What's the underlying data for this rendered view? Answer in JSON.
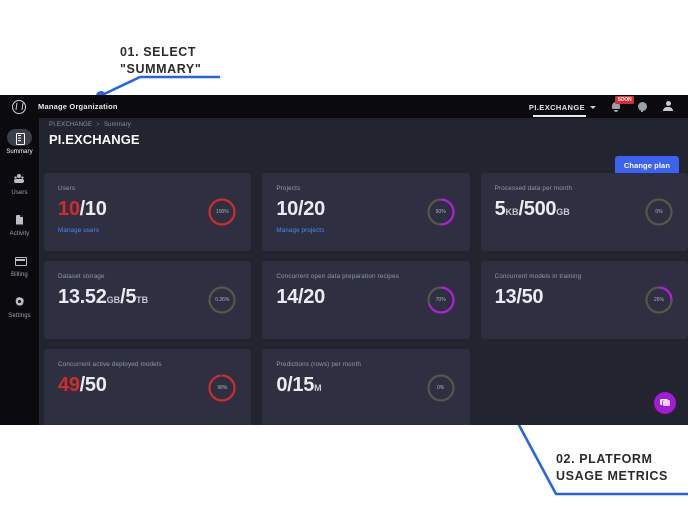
{
  "annotations": [
    {
      "id": "a1",
      "text": "01. SELECT\n\"SUMMARY\""
    },
    {
      "id": "a2",
      "text": "02. PLATFORM\nUSAGE METRICS"
    }
  ],
  "colors": {
    "accent_blue": "#3b63f0",
    "annotation_blue": "#2563eb",
    "danger_red": "#d22b2b",
    "ring_purple": "#b51ae0",
    "chat_purple": "#a31bd4",
    "app_bg": "#22242f",
    "card_bg": "#2e3042",
    "rail_bg": "#0b0b0f"
  },
  "topbar": {
    "logo_icon": "pi-exchange-logo-icon",
    "title": "Manage Organization",
    "org_switcher": {
      "label": "PI.EXCHANGE",
      "caret_icon": "chevron-down-icon"
    },
    "bell_icon": "bell-icon",
    "notification_badge": "SOON",
    "help_icon": "help-globe-icon",
    "user_icon": "user-avatar-icon"
  },
  "sidebar": {
    "items": [
      {
        "label": "Summary",
        "icon": "summary-icon",
        "active": true
      },
      {
        "label": "Users",
        "icon": "users-icon",
        "active": false
      },
      {
        "label": "Activity",
        "icon": "activity-icon",
        "active": false
      },
      {
        "label": "Billing",
        "icon": "billing-icon",
        "active": false
      },
      {
        "label": "Settings",
        "icon": "settings-icon",
        "active": false
      }
    ]
  },
  "main": {
    "breadcrumb": {
      "root": "PI.EXCHANGE",
      "separator": ">",
      "current": "Summary"
    },
    "page_title": "PI.EXCHANGE",
    "change_plan_label": "Change plan",
    "chat_icon": "chat-bubble-icon"
  },
  "chart_data": {
    "type": "table",
    "title": "Platform usage metrics",
    "columns": [
      "metric",
      "used",
      "unit_used",
      "limit",
      "unit_limit",
      "percent"
    ],
    "rows": [
      {
        "metric": "Users",
        "used": "10",
        "unit_used": "",
        "limit": "10",
        "unit_limit": "",
        "percent": 100,
        "percent_label": "100%",
        "color": "#d22b2b",
        "danger": true,
        "link": "Manage users"
      },
      {
        "metric": "Projects",
        "used": "10",
        "unit_used": "",
        "limit": "20",
        "unit_limit": "",
        "percent": 50,
        "percent_label": "50%",
        "color": "#b51ae0",
        "danger": false,
        "link": "Manage projects"
      },
      {
        "metric": "Processed data per month",
        "used": "5",
        "unit_used": "KB",
        "limit": "500",
        "unit_limit": "GB",
        "percent": 0,
        "percent_label": "0%",
        "color": "#6e6f5a",
        "danger": false,
        "link": ""
      },
      {
        "metric": "Dataset storage",
        "used": "13.52",
        "unit_used": "GB",
        "limit": "5",
        "unit_limit": "TB",
        "percent": 0.26,
        "percent_label": "0.26%",
        "color": "#6e6f5a",
        "danger": false,
        "link": ""
      },
      {
        "metric": "Concurrent open data preparation recipes",
        "used": "14",
        "unit_used": "",
        "limit": "20",
        "unit_limit": "",
        "percent": 70,
        "percent_label": "70%",
        "color": "#b51ae0",
        "danger": false,
        "link": ""
      },
      {
        "metric": "Concurrent models in training",
        "used": "13",
        "unit_used": "",
        "limit": "50",
        "unit_limit": "",
        "percent": 26,
        "percent_label": "26%",
        "color": "#b51ae0",
        "danger": false,
        "link": ""
      },
      {
        "metric": "Concurrent active deployed models",
        "used": "49",
        "unit_used": "",
        "limit": "50",
        "unit_limit": "",
        "percent": 98,
        "percent_label": "98%",
        "color": "#d22b2b",
        "danger": true,
        "link": ""
      },
      {
        "metric": "Predictions (rows) per month",
        "used": "0",
        "unit_used": "",
        "limit": "15",
        "unit_limit": "M",
        "percent": 0,
        "percent_label": "0%",
        "color": "#6e6f5a",
        "danger": false,
        "link": ""
      }
    ]
  }
}
